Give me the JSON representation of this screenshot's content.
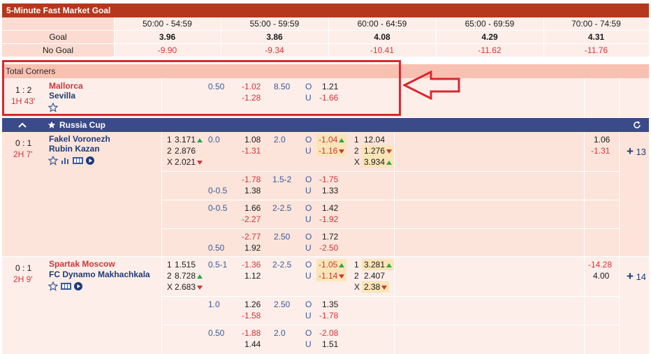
{
  "fast_market": {
    "title": "5-Minute Fast Market Goal",
    "columns": [
      "50:00 - 54:59",
      "55:00 - 59:59",
      "60:00 - 64:59",
      "65:00 - 69:59",
      "70:00 - 74:59"
    ],
    "goal_label": "Goal",
    "goal_values": [
      "3.96",
      "3.86",
      "4.08",
      "4.29",
      "4.31"
    ],
    "nogoal_label": "No Goal",
    "nogoal_values": [
      "-9.90",
      "-9.34",
      "-10.41",
      "-11.62",
      "-11.76"
    ]
  },
  "corners": {
    "title": "Total Corners",
    "score": "1 : 2",
    "time": "1H 43'",
    "home": "Mallorca",
    "away": "Sevilla",
    "hdp": "0.50",
    "hdp_home": "-1.02",
    "hdp_away": "-1.28",
    "ou_line": "8.50",
    "over_label": "O",
    "under_label": "U",
    "over": "1.21",
    "under": "-1.66"
  },
  "league": {
    "name": "Russia Cup"
  },
  "match1": {
    "score": "0 : 1",
    "time": "2H 7'",
    "home": "Fakel Voronezh",
    "away": "Rubin Kazan",
    "x12_1": "3.171",
    "x12_2": "2.876",
    "x12_x": "2.021",
    "lab1": "1",
    "lab2": "2",
    "labx": "X",
    "rows": [
      {
        "hdp": "0.0",
        "h": "1.08",
        "a": "-1.31",
        "ou": "2.0",
        "o": "-1.04",
        "u": "-1.16"
      },
      {
        "hdp": "0-0.5",
        "h": "-1.78",
        "a": "1.38",
        "ou": "1.5-2",
        "o": "-1.75",
        "u": "1.33"
      },
      {
        "hdp": "0-0.5",
        "h": "1.66",
        "a": "-2.27",
        "ou": "2-2.5",
        "o": "1.42",
        "u": "-1.92"
      },
      {
        "hdp": "0.50",
        "h": "-2.77",
        "a": "1.92",
        "ou": "2.50",
        "o": "1.72",
        "u": "-2.50"
      }
    ],
    "fh_1": "12.04",
    "fh_2": "1.276",
    "fh_x": "3.934",
    "extra_1": "1.06",
    "extra_2": "-1.31",
    "more": "13"
  },
  "match2": {
    "score": "0 : 1",
    "time": "2H 9'",
    "home": "Spartak Moscow",
    "away": "FC Dynamo Makhachkala",
    "x12_1": "1.515",
    "x12_2": "8.728",
    "x12_x": "2.683",
    "rows": [
      {
        "hdp": "0.5-1",
        "h": "-1.36",
        "a": "1.12",
        "ou": "2-2.5",
        "o": "-1.05",
        "u": "-1.14"
      },
      {
        "hdp": "1.0",
        "h": "1.26",
        "a": "-1.58",
        "ou": "2.50",
        "o": "1.35",
        "u": "-1.78"
      },
      {
        "hdp": "0.50",
        "h": "-1.88",
        "a": "1.44",
        "ou": "2.0",
        "o": "-2.08",
        "u": "1.51"
      }
    ],
    "fh_1": "3.281",
    "fh_2": "2.407",
    "fh_x": "2.38",
    "extra_1": "-14.28",
    "extra_2": "4.00",
    "more": "14"
  },
  "colors": {
    "header": "#b5371d",
    "league": "#3b4a89",
    "highlight": "#d9282f"
  }
}
